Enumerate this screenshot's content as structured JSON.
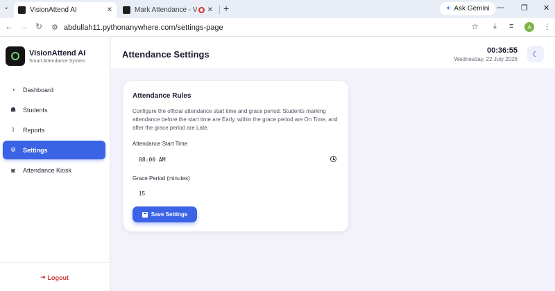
{
  "browser": {
    "tabs": [
      {
        "title": "VisionAttend AI",
        "active": true
      },
      {
        "title": "Mark Attendance - VisionA",
        "active": false
      }
    ],
    "ask_gemini": "Ask Gemini",
    "url": "abdullah11.pythonanywhere.com/settings-page",
    "profile_initial": "A"
  },
  "brand": {
    "name": "VisionAttend AI",
    "subtitle": "Smart Attendance System"
  },
  "sidebar": {
    "items": [
      {
        "label": "Dashboard",
        "icon": "dashboard-icon",
        "active": false
      },
      {
        "label": "Students",
        "icon": "students-icon",
        "active": false
      },
      {
        "label": "Reports",
        "icon": "reports-icon",
        "active": false
      },
      {
        "label": "Settings",
        "icon": "gear-icon",
        "active": true
      },
      {
        "label": "Attendance Kiosk",
        "icon": "camera-icon",
        "active": false
      }
    ],
    "logout_label": "Logout"
  },
  "header": {
    "title": "Attendance Settings",
    "time": "00:36:55",
    "date": "Wednesday, 22 July 2026"
  },
  "card": {
    "title": "Attendance Rules",
    "description": "Configure the official attendance start time and grace period. Students marking attendance before the start time are Early, within the grace period are On Time, and after the grace period are Late.",
    "start_time_label": "Attendance Start Time",
    "start_time_value": "08:00 AM",
    "grace_label": "Grace Period (minutes)",
    "grace_value": "15",
    "save_label": "Save Settings"
  },
  "colors": {
    "accent": "#3b63e6",
    "logout": "#cf3b3b",
    "background": "#f3f2fb"
  }
}
